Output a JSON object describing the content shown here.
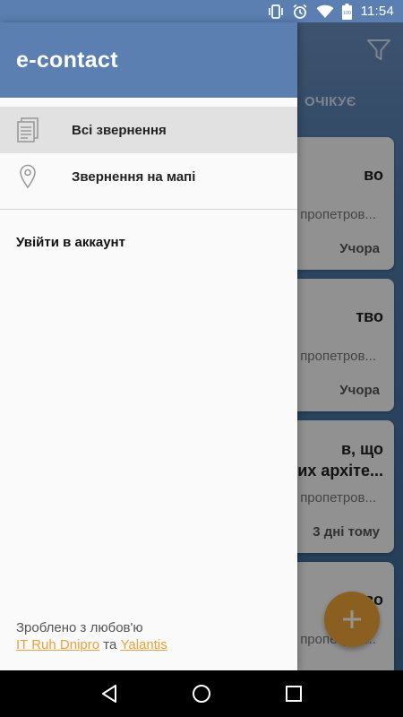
{
  "status_bar": {
    "time": "11:54",
    "icons": [
      "vibrate-icon",
      "alarm-icon",
      "wifi-icon",
      "battery-icon"
    ],
    "battery_level": "100"
  },
  "background": {
    "tab_label": "ОЧІКУЄ",
    "cards": [
      {
        "title": "во",
        "address": "пропетров...",
        "date": "Учора"
      },
      {
        "title": "тво",
        "address": "пропетров...",
        "date": "Учора"
      },
      {
        "title": "в, що\nних архіте...",
        "address": "пропетров...",
        "date": "3 дні тому"
      },
      {
        "title": "тво",
        "address": "пропетров...",
        "date": ""
      }
    ]
  },
  "drawer": {
    "app_title": "e-contact",
    "menu": [
      {
        "label": "Всі звернення",
        "icon": "documents-icon",
        "active": true
      },
      {
        "label": "Звернення на мапі",
        "icon": "map-pin-icon",
        "active": false
      }
    ],
    "login_label": "Увійти в аккаунт",
    "footer": {
      "text": "Зроблено з любов'ю",
      "link1": "IT Ruh Dnipro",
      "conj": "та",
      "link2": "Yalantis"
    }
  },
  "colors": {
    "primary": "#5a7fb0",
    "accent": "#f0a438",
    "link": "#e9a13b",
    "active_item": "#e1e1e1"
  }
}
